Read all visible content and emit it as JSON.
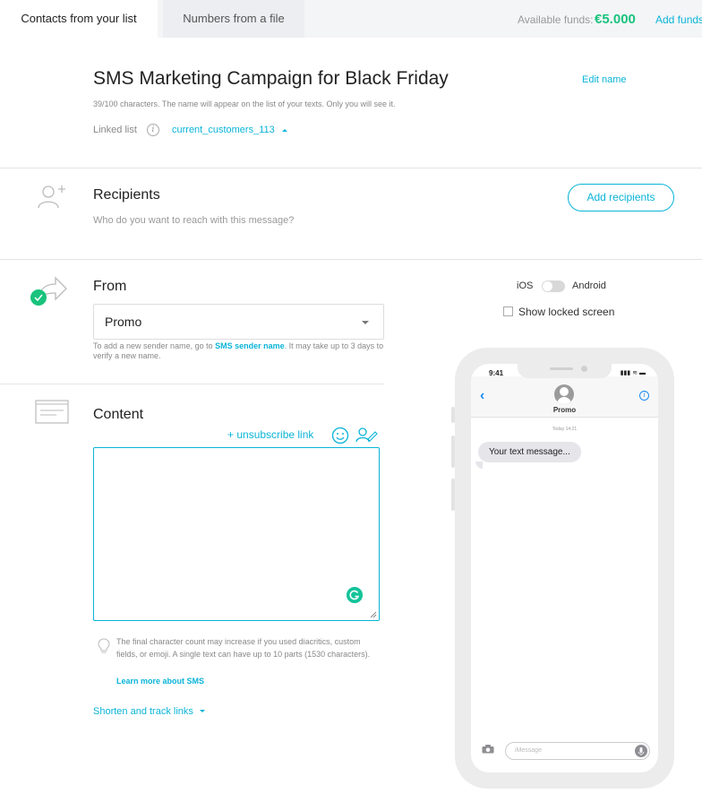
{
  "tabs": [
    {
      "label": "Contacts from your list",
      "active": true
    },
    {
      "label": "Numbers from a file",
      "active": false
    }
  ],
  "funds": {
    "label": "Available funds:",
    "value": "€5.000",
    "add_label": "Add funds"
  },
  "campaign": {
    "title": "SMS Marketing Campaign for Black Friday",
    "edit_label": "Edit name",
    "hint": "39/100 characters. The name will appear on the list of your texts. Only you will see it.",
    "linked_label": "Linked list",
    "linked_value": "current_customers_113",
    "info_glyph": "i"
  },
  "recipients": {
    "title": "Recipients",
    "subtitle": "Who do you want to reach with this message?",
    "button": "Add recipients"
  },
  "from": {
    "title": "From",
    "selected": "Promo",
    "note_prefix": "To add a new sender name, go to ",
    "note_link": "SMS sender name",
    "note_suffix": ". It may take up to 3 days to verify a new name."
  },
  "content": {
    "title": "Content",
    "unsubscribe_link": "+ unsubscribe link",
    "textarea_value": "",
    "tip": "The final character count may increase if you used diacritics, custom fields, or emoji. A single text can have up to 10 parts (1530 characters).",
    "tip_link": "Learn more about SMS",
    "shorten_link": "Shorten and track links"
  },
  "preview": {
    "ios_label": "iOS",
    "android_label": "Android",
    "locked_label": "Show locked screen",
    "phone": {
      "time": "9:41",
      "status_icons": "▮▮▮ ≋ ▬",
      "back_glyph": "‹",
      "contact": "Promo",
      "info_glyph": "i",
      "timestamp": "Today 14:21",
      "message": "Your text message...",
      "input_placeholder": "iMessage"
    }
  },
  "colors": {
    "accent": "#0ab4d8",
    "success": "#19c37d",
    "grammarly": "#15c39a"
  }
}
